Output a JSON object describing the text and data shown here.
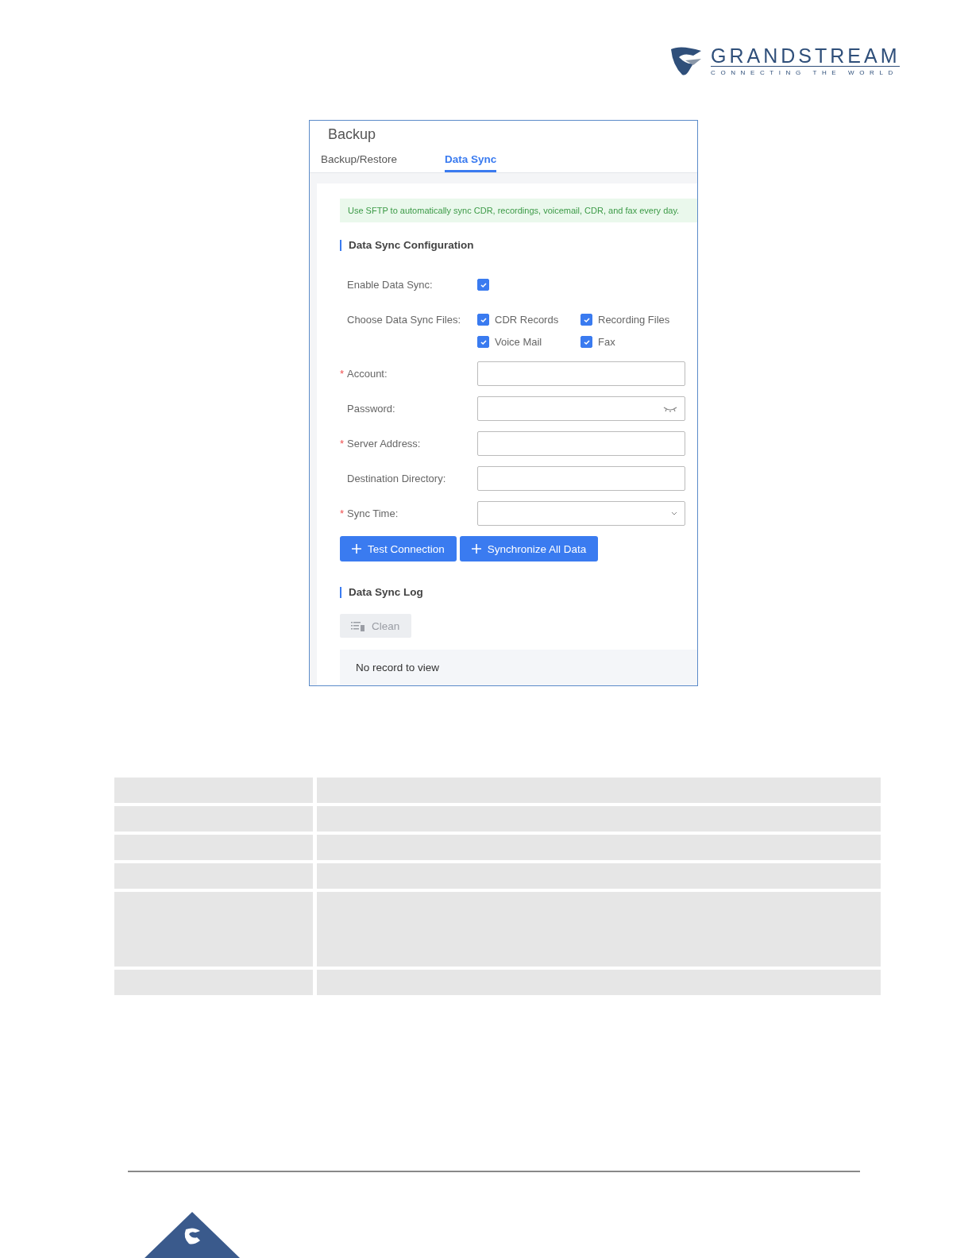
{
  "logo": {
    "name": "GRANDSTREAM",
    "tagline": "CONNECTING THE WORLD"
  },
  "window": {
    "title": "Backup"
  },
  "tabs": [
    {
      "label": "Backup/Restore",
      "selected": false
    },
    {
      "label": "Data Sync",
      "selected": true
    }
  ],
  "notice": "Use SFTP to automatically sync CDR, recordings, voicemail, CDR, and fax every day.",
  "config": {
    "heading": "Data Sync Configuration",
    "enable": {
      "label": "Enable Data Sync:",
      "checked": true
    },
    "files": {
      "label": "Choose Data Sync Files:",
      "options": [
        {
          "label": "CDR Records",
          "checked": true
        },
        {
          "label": "Recording Files",
          "checked": true
        },
        {
          "label": "Voice Mail",
          "checked": true
        },
        {
          "label": "Fax",
          "checked": true
        }
      ]
    },
    "fields": [
      {
        "kind": "text",
        "label": "Account:",
        "required_mark": "*"
      },
      {
        "kind": "password",
        "label": "Password:"
      },
      {
        "kind": "text",
        "label": "Server Address:",
        "required_mark": "*"
      },
      {
        "kind": "text",
        "label": "Destination Directory:"
      },
      {
        "kind": "select",
        "label": "Sync Time:",
        "required_mark": "*"
      }
    ],
    "buttons": [
      "Test Connection",
      "Synchronize All Data"
    ]
  },
  "log": {
    "heading": "Data Sync Log",
    "clean_button": {
      "label": "Clean",
      "disabled": true
    },
    "empty_text": "No record to view"
  },
  "table": {
    "rows": [
      {
        "kind": "short"
      },
      {
        "kind": "short"
      },
      {
        "kind": "short"
      },
      {
        "kind": "short"
      },
      {
        "kind": "tall"
      },
      {
        "kind": "short"
      }
    ]
  }
}
